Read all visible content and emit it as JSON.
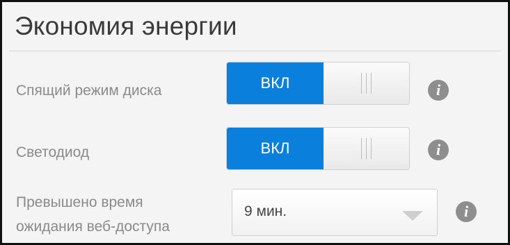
{
  "section": {
    "title": "Экономия энергии"
  },
  "settings": [
    {
      "label": "Спящий режим диска",
      "state": "ВКЛ"
    },
    {
      "label": "Светодиод",
      "state": "ВКЛ"
    }
  ],
  "timeout": {
    "label_line1": "Превышено время",
    "label_line2": "ожидания веб-доступа",
    "value": "9 мин."
  },
  "icons": {
    "info": "info-icon",
    "toggle_grip": "grip-lines-icon",
    "dropdown": "chevron-down-icon"
  },
  "colors": {
    "accent": "#0a7fdb",
    "info_icon": "#8e8e8e",
    "label_text": "#8a8a8a"
  }
}
